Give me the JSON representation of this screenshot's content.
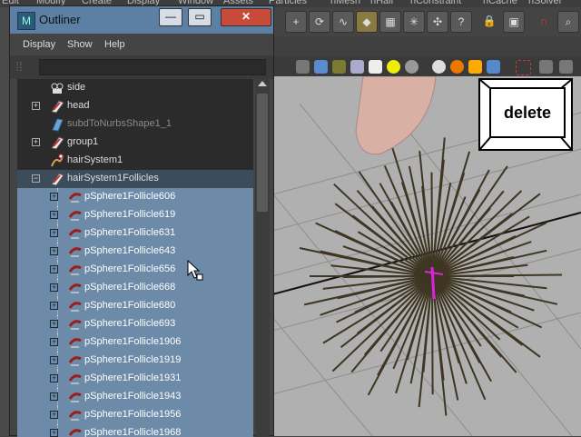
{
  "app": {
    "menubar": [
      "Edit",
      "Modify",
      "Create",
      "Display",
      "Window",
      "Assets",
      "Particles",
      "nMesh",
      "nHair",
      "nConstraint",
      "nCache",
      "nSolver"
    ]
  },
  "outliner": {
    "title": "Outliner",
    "window_buttons": {
      "minimize": "—",
      "maximize": "▭",
      "close": "✕"
    },
    "menu": [
      "Display",
      "Show",
      "Help"
    ],
    "search": {
      "value": ""
    },
    "tree": [
      {
        "label": "side",
        "icon": "camera-icon",
        "expandable": false,
        "state": "normal"
      },
      {
        "label": "head",
        "icon": "transform-icon",
        "expandable": true,
        "state": "normal"
      },
      {
        "label": "subdToNurbsShape1_1",
        "icon": "nurbs-surface-icon",
        "expandable": false,
        "state": "dim"
      },
      {
        "label": "group1",
        "icon": "transform-icon",
        "expandable": true,
        "state": "normal"
      },
      {
        "label": "hairSystem1",
        "icon": "hair-system-icon",
        "expandable": false,
        "state": "normal"
      },
      {
        "label": "hairSystem1Follicles",
        "icon": "transform-icon",
        "expandable": true,
        "expanded": true,
        "state": "header"
      },
      {
        "label": "pSphere1Follicle606",
        "icon": "follicle-icon",
        "expandable": true,
        "state": "selected"
      },
      {
        "label": "pSphere1Follicle619",
        "icon": "follicle-icon",
        "expandable": true,
        "state": "selected"
      },
      {
        "label": "pSphere1Follicle631",
        "icon": "follicle-icon",
        "expandable": true,
        "state": "selected"
      },
      {
        "label": "pSphere1Follicle643",
        "icon": "follicle-icon",
        "expandable": true,
        "state": "selected"
      },
      {
        "label": "pSphere1Follicle656",
        "icon": "follicle-icon",
        "expandable": true,
        "state": "selected"
      },
      {
        "label": "pSphere1Follicle668",
        "icon": "follicle-icon",
        "expandable": true,
        "state": "selected"
      },
      {
        "label": "pSphere1Follicle680",
        "icon": "follicle-icon",
        "expandable": true,
        "state": "selected"
      },
      {
        "label": "pSphere1Follicle693",
        "icon": "follicle-icon",
        "expandable": true,
        "state": "selected"
      },
      {
        "label": "pSphere1Follicle1906",
        "icon": "follicle-icon",
        "expandable": true,
        "state": "selected"
      },
      {
        "label": "pSphere1Follicle1919",
        "icon": "follicle-icon",
        "expandable": true,
        "state": "selected"
      },
      {
        "label": "pSphere1Follicle1931",
        "icon": "follicle-icon",
        "expandable": true,
        "state": "selected"
      },
      {
        "label": "pSphere1Follicle1943",
        "icon": "follicle-icon",
        "expandable": true,
        "state": "selected"
      },
      {
        "label": "pSphere1Follicle1956",
        "icon": "follicle-icon",
        "expandable": true,
        "state": "selected"
      },
      {
        "label": "pSphere1Follicle1968",
        "icon": "follicle-icon",
        "expandable": true,
        "state": "selected"
      }
    ]
  },
  "overlay": {
    "key_label": "delete"
  },
  "colors": {
    "titlebar": "#5c7fa4",
    "selection": "#6d8aa8",
    "viewport_bg": "#b0b0b0",
    "hair": "#3e3522",
    "magenta": "#e020e0"
  }
}
